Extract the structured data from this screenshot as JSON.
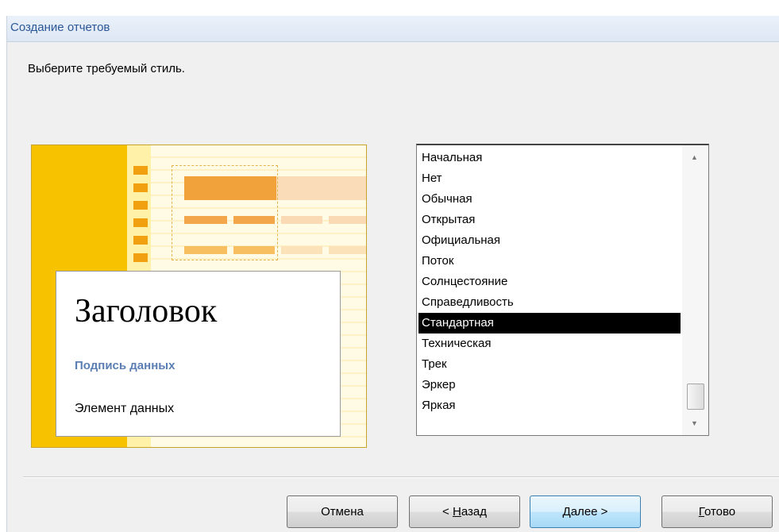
{
  "window": {
    "title": "Создание отчетов"
  },
  "instruction": "Выберите требуемый стиль.",
  "preview": {
    "heading": "Заголовок",
    "data_label": "Подпись данных",
    "data_item": "Элемент данных"
  },
  "style_list": {
    "items": [
      "Начальная",
      "Нет",
      "Обычная",
      "Открытая",
      "Официальная",
      "Поток",
      "Солнцестояние",
      "Справедливость",
      "Стандартная",
      "Техническая",
      "Трек",
      "Эркер",
      "Яркая"
    ],
    "selected": "Стандартная"
  },
  "buttons": {
    "cancel": "Отмена",
    "back_prefix": "< ",
    "back_key": "Н",
    "back_rest": "азад",
    "next_key": "Д",
    "next_rest": "алее >",
    "finish_key": "Г",
    "finish_rest": "отово"
  },
  "colors": {
    "selection": "#000000",
    "title_text": "#2b5797",
    "preview_accent": "#f7c200"
  }
}
